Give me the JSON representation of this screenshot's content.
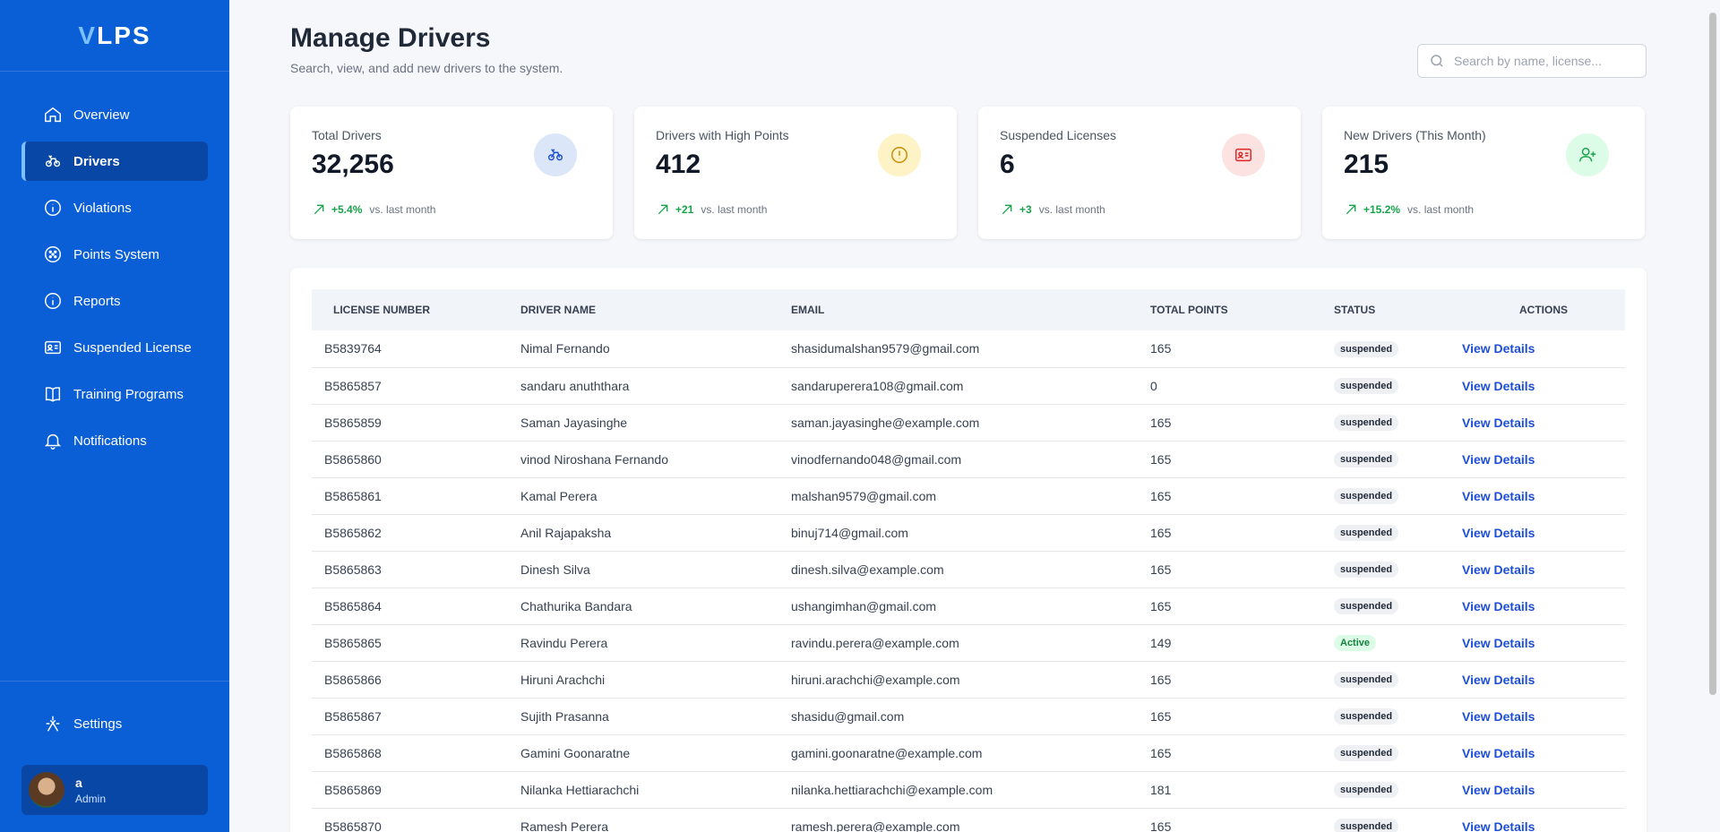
{
  "app": {
    "logo_v": "V",
    "logo_rest": "LPS"
  },
  "sidebar": {
    "items": [
      {
        "label": "Overview",
        "icon": "home-icon"
      },
      {
        "label": "Drivers",
        "icon": "drivers-icon"
      },
      {
        "label": "Violations",
        "icon": "info-icon"
      },
      {
        "label": "Points System",
        "icon": "points-icon"
      },
      {
        "label": "Reports",
        "icon": "info-icon"
      },
      {
        "label": "Suspended License",
        "icon": "id-card-icon"
      },
      {
        "label": "Training Programs",
        "icon": "book-icon"
      },
      {
        "label": "Notifications",
        "icon": "bell-icon"
      }
    ],
    "active_item": "Drivers",
    "settings_label": "Settings",
    "user": {
      "name": "a",
      "role": "Admin"
    }
  },
  "header": {
    "title": "Manage Drivers",
    "subtitle": "Search, view, and add new drivers to the system.",
    "search_placeholder": "Search by name, license..."
  },
  "cards": [
    {
      "label": "Total Drivers",
      "value": "32,256",
      "trend": "+5.4%",
      "trend_note": "vs. last month",
      "icon": "drivers-icon",
      "icon_bg": "#dbe7f8",
      "icon_color": "#1d4ed8"
    },
    {
      "label": "Drivers with High Points",
      "value": "412",
      "trend": "+21",
      "trend_note": "vs. last month",
      "icon": "alert-icon",
      "icon_bg": "#fef3c7",
      "icon_color": "#ca8a04"
    },
    {
      "label": "Suspended Licenses",
      "value": "6",
      "trend": "+3",
      "trend_note": "vs. last month",
      "icon": "id-card-icon",
      "icon_bg": "#fde2e2",
      "icon_color": "#dc2626"
    },
    {
      "label": "New Drivers (This Month)",
      "value": "215",
      "trend": "+15.2%",
      "trend_note": "vs. last month",
      "icon": "user-plus-icon",
      "icon_bg": "#dcfce7",
      "icon_color": "#16a34a"
    }
  ],
  "table": {
    "columns": [
      "LICENSE NUMBER",
      "DRIVER NAME",
      "EMAIL",
      "TOTAL POINTS",
      "STATUS",
      "ACTIONS"
    ],
    "action_label": "View Details",
    "rows": [
      {
        "license": "B5839764",
        "name": "Nimal Fernando",
        "email": "shasidumalshan9579@gmail.com",
        "points": "165",
        "status": "suspended"
      },
      {
        "license": "B5865857",
        "name": "sandaru anuththara",
        "email": "sandaruperera108@gmail.com",
        "points": "0",
        "status": "suspended"
      },
      {
        "license": "B5865859",
        "name": "Saman Jayasinghe",
        "email": "saman.jayasinghe@example.com",
        "points": "165",
        "status": "suspended"
      },
      {
        "license": "B5865860",
        "name": "vinod Niroshana Fernando",
        "email": "vinodfernando048@gmail.com",
        "points": "165",
        "status": "suspended"
      },
      {
        "license": "B5865861",
        "name": "Kamal Perera",
        "email": "malshan9579@gmail.com",
        "points": "165",
        "status": "suspended"
      },
      {
        "license": "B5865862",
        "name": "Anil Rajapaksha",
        "email": "binuj714@gmail.com",
        "points": "165",
        "status": "suspended"
      },
      {
        "license": "B5865863",
        "name": "Dinesh Silva",
        "email": "dinesh.silva@example.com",
        "points": "165",
        "status": "suspended"
      },
      {
        "license": "B5865864",
        "name": "Chathurika Bandara",
        "email": "ushangimhan@gmail.com",
        "points": "165",
        "status": "suspended"
      },
      {
        "license": "B5865865",
        "name": "Ravindu Perera",
        "email": "ravindu.perera@example.com",
        "points": "149",
        "status": "Active"
      },
      {
        "license": "B5865866",
        "name": "Hiruni Arachchi",
        "email": "hiruni.arachchi@example.com",
        "points": "165",
        "status": "suspended"
      },
      {
        "license": "B5865867",
        "name": "Sujith Prasanna",
        "email": "shasidu@gmail.com",
        "points": "165",
        "status": "suspended"
      },
      {
        "license": "B5865868",
        "name": "Gamini Goonaratne",
        "email": "gamini.goonaratne@example.com",
        "points": "165",
        "status": "suspended"
      },
      {
        "license": "B5865869",
        "name": "Nilanka Hettiarachchi",
        "email": "nilanka.hettiarachchi@example.com",
        "points": "181",
        "status": "suspended"
      },
      {
        "license": "B5865870",
        "name": "Ramesh Perera",
        "email": "ramesh.perera@example.com",
        "points": "165",
        "status": "suspended"
      }
    ]
  }
}
